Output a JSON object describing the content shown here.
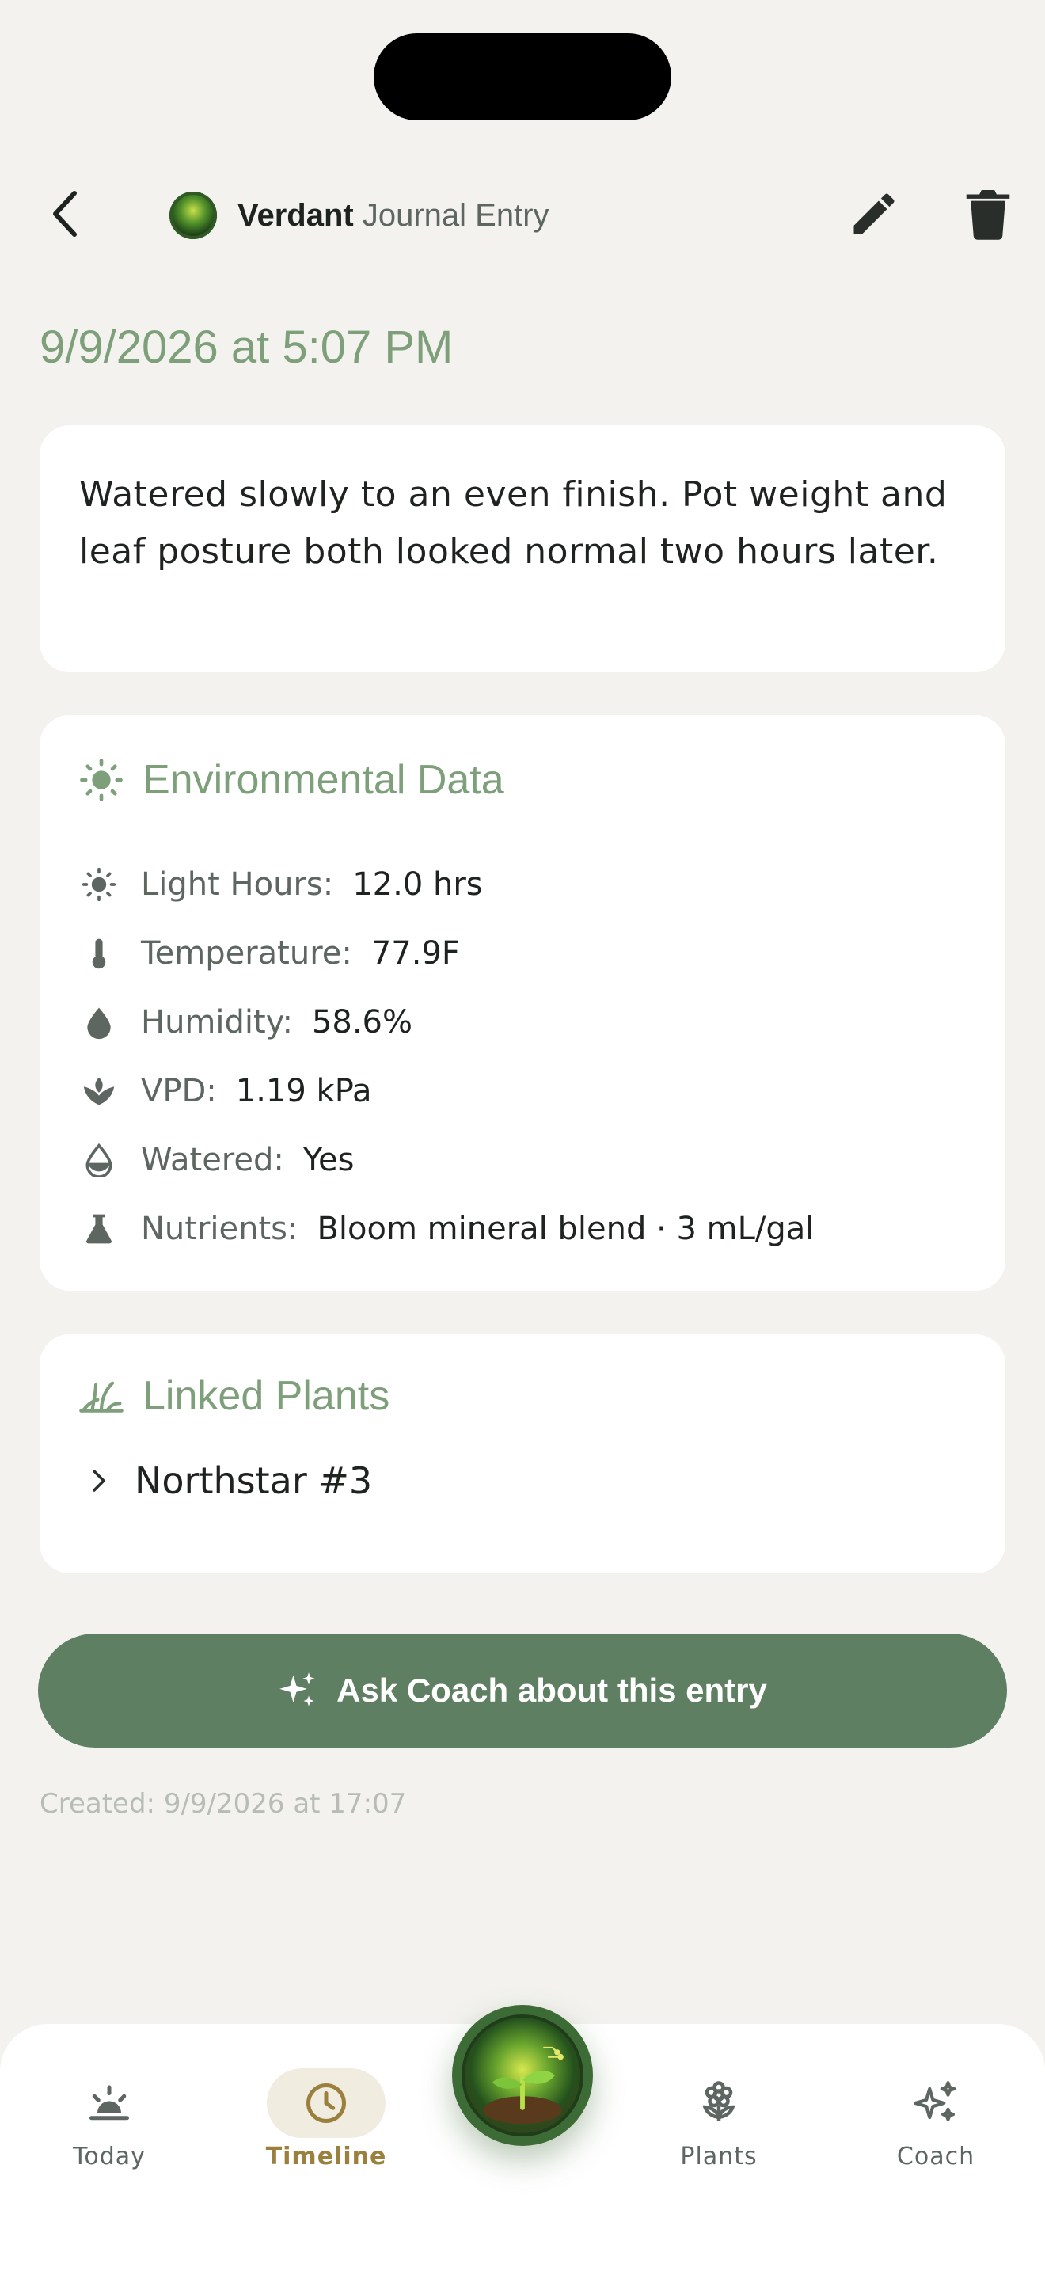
{
  "header": {
    "brand": "Verdant",
    "title": "Journal Entry"
  },
  "entry": {
    "datetime": "9/9/2026 at 5:07 PM",
    "notes": "Watered slowly to an even finish. Pot weight and leaf posture both looked normal two hours later."
  },
  "environment": {
    "title": "Environmental Data",
    "rows": [
      {
        "icon": "sun-icon",
        "label": "Light Hours:",
        "value": "12.0 hrs"
      },
      {
        "icon": "thermometer-icon",
        "label": "Temperature:",
        "value": "77.9F"
      },
      {
        "icon": "droplet-icon",
        "label": "Humidity:",
        "value": "58.6%"
      },
      {
        "icon": "leaf-cup-icon",
        "label": "VPD:",
        "value": "1.19 kPa"
      },
      {
        "icon": "water-drop-icon",
        "label": "Watered:",
        "value": "Yes"
      },
      {
        "icon": "flask-icon",
        "label": "Nutrients:",
        "value": "Bloom mineral blend · 3 mL/gal"
      }
    ]
  },
  "linked_plants": {
    "title": "Linked Plants",
    "items": [
      {
        "name": "Northstar #3"
      }
    ]
  },
  "coach_button": {
    "label": "Ask Coach about this entry"
  },
  "created": "Created: 9/9/2026 at 17:07",
  "tabs": [
    {
      "label": "Today",
      "icon": "sunrise-icon"
    },
    {
      "label": "Timeline",
      "icon": "clock-icon",
      "active": true
    },
    {
      "label": "Plants",
      "icon": "flower-icon"
    },
    {
      "label": "Coach",
      "icon": "sparkles-icon"
    }
  ],
  "colors": {
    "accent": "#7d9f79",
    "button": "#5e7f62",
    "active_tab": "#9b7f3d",
    "background": "#f3f2ef"
  }
}
